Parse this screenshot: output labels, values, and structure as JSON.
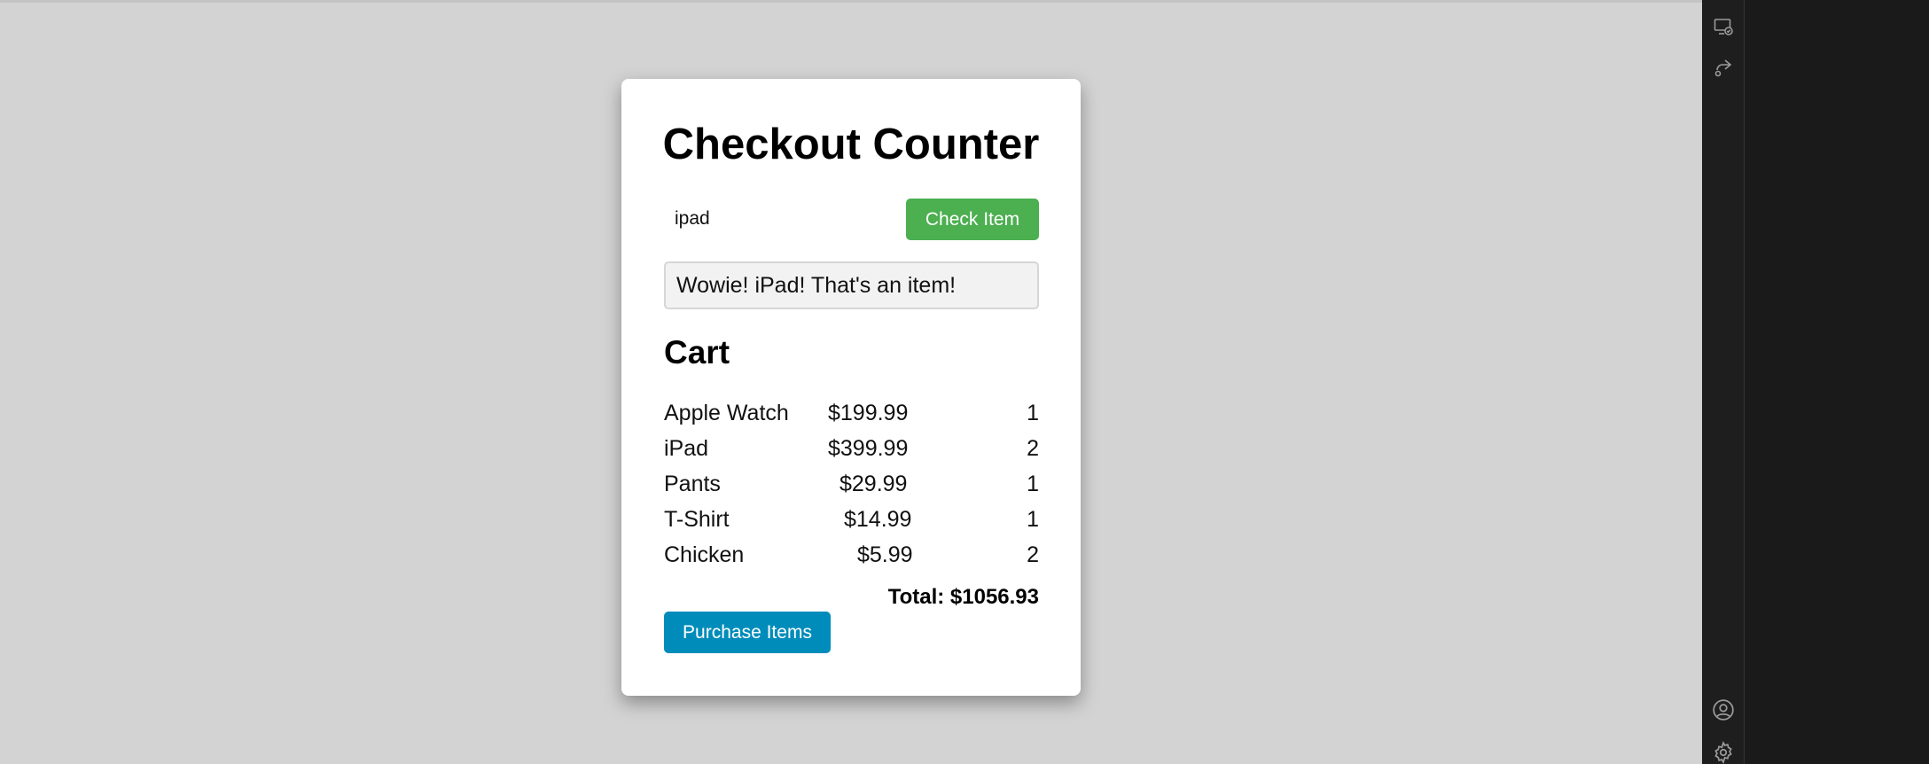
{
  "app": {
    "title": "Checkout Counter"
  },
  "checker": {
    "input_value": "ipad",
    "button_label": "Check Item",
    "message": "Wowie! iPad! That's an item!"
  },
  "cart": {
    "heading": "Cart",
    "items": [
      {
        "name": "Apple Watch",
        "price": "$199.99",
        "qty": "1"
      },
      {
        "name": "iPad",
        "price": "$399.99",
        "qty": "2"
      },
      {
        "name": "Pants",
        "price": "$29.99",
        "qty": "1"
      },
      {
        "name": "T-Shirt",
        "price": "$14.99",
        "qty": "1"
      },
      {
        "name": "Chicken",
        "price": "$5.99",
        "qty": "2"
      }
    ],
    "total": "Total: $1056.93",
    "purchase_label": "Purchase Items"
  },
  "colors": {
    "check_button": "#4caf50",
    "purchase_button": "#008cba",
    "page_background": "#d3d3d3"
  },
  "sidebar_icons": [
    "screen-share-icon",
    "share-arrow-icon",
    "account-icon",
    "settings-gear-icon"
  ]
}
